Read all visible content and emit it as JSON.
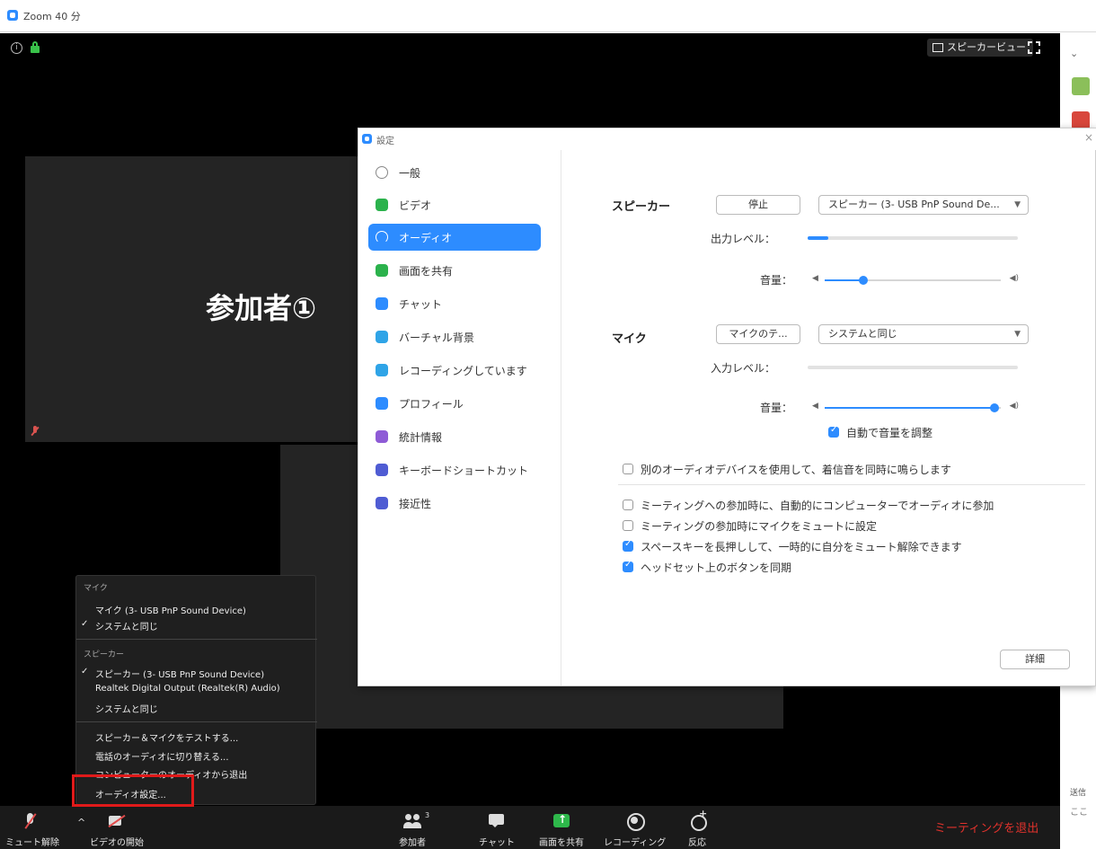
{
  "window": {
    "title": "Zoom 40 分"
  },
  "meeting": {
    "speaker_view_label": "スピーカービュー",
    "participant_name": "参加者①"
  },
  "toolbar": {
    "unmute_label": "ミュート解除",
    "video_label": "ビデオの開始",
    "participants_label": "参加者",
    "participants_count": "3",
    "chat_label": "チャット",
    "share_label": "画面を共有",
    "record_label": "レコーディング",
    "react_label": "反応",
    "leave_label": "ミーティングを退出"
  },
  "audio_menu": {
    "mic_header": "マイク",
    "mic_items": [
      "マイク (3- USB PnP Sound Device)",
      "システムと同じ"
    ],
    "mic_selected": 1,
    "speaker_header": "スピーカー",
    "speaker_items": [
      "スピーカー (3- USB PnP Sound Device)",
      "Realtek Digital Output (Realtek(R) Audio)",
      "システムと同じ"
    ],
    "speaker_selected": 0,
    "actions": [
      "スピーカー＆マイクをテストする...",
      "電話のオーディオに切り替える...",
      "コンピューターのオーディオから退出",
      "オーディオ設定..."
    ],
    "check_mark": "✓"
  },
  "settings": {
    "title": "設定",
    "nav": [
      {
        "label": "一般",
        "icon": "general-icon"
      },
      {
        "label": "ビデオ",
        "icon": "video-icon"
      },
      {
        "label": "オーディオ",
        "icon": "headphones-icon"
      },
      {
        "label": "画面を共有",
        "icon": "share-screen-icon"
      },
      {
        "label": "チャット",
        "icon": "chat-icon"
      },
      {
        "label": "バーチャル背景",
        "icon": "virtual-background-icon"
      },
      {
        "label": "レコーディングしています",
        "icon": "recording-icon"
      },
      {
        "label": "プロフィール",
        "icon": "profile-icon"
      },
      {
        "label": "統計情報",
        "icon": "statistics-icon"
      },
      {
        "label": "キーボードショートカット",
        "icon": "keyboard-icon"
      },
      {
        "label": "接近性",
        "icon": "accessibility-icon"
      }
    ],
    "active_nav": 2,
    "speaker": {
      "label": "スピーカー",
      "stop_button": "停止",
      "device": "スピーカー (3- USB PnP Sound De...",
      "output_level_label": "出力レベル：",
      "output_level": 0.1,
      "volume_label": "音量：",
      "volume": 0.2
    },
    "mic": {
      "label": "マイク",
      "test_button": "マイクのテ...",
      "device": "システムと同じ",
      "input_level_label": "入力レベル：",
      "input_level": 0.0,
      "volume_label": "音量：",
      "volume": 1.0,
      "auto_adjust_label": "自動で音量を調整",
      "auto_adjust": true
    },
    "options": [
      {
        "label": "別のオーディオデバイスを使用して、着信音を同時に鳴らします",
        "checked": false
      },
      {
        "label": "ミーティングへの参加時に、自動的にコンピューターでオーディオに参加",
        "checked": false
      },
      {
        "label": "ミーティングの参加時にマイクをミュートに設定",
        "checked": false
      },
      {
        "label": "スペースキーを長押しして、一時的に自分をミュート解除できます",
        "checked": true
      },
      {
        "label": "ヘッドセット上のボタンを同期",
        "checked": true
      }
    ],
    "advanced_button": "詳細",
    "close_glyph": "×"
  },
  "right_strip": {
    "text1": "送信",
    "text2": "ここ"
  }
}
